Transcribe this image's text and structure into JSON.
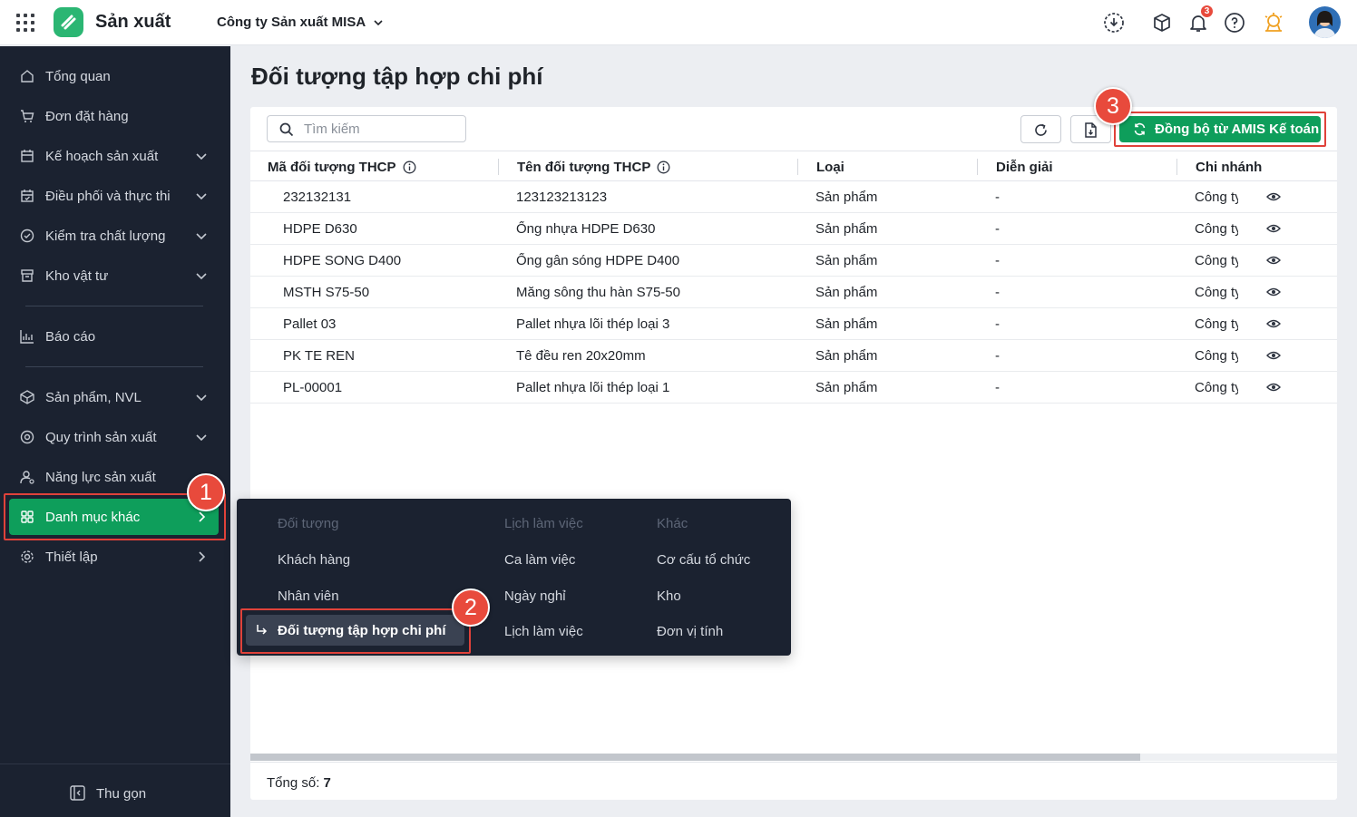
{
  "header": {
    "app_name": "Sản xuất",
    "company": "Công ty Sản xuất MISA",
    "notification_count": "3",
    "icons": [
      "apps-grid-icon",
      "download-icon",
      "box-icon",
      "bell-icon",
      "help-icon",
      "award-icon"
    ]
  },
  "sidebar": {
    "items": [
      {
        "label": "Tổng quan",
        "icon": "home-icon"
      },
      {
        "label": "Đơn đặt hàng",
        "icon": "cart-icon"
      },
      {
        "label": "Kế hoạch sản xuất",
        "icon": "calendar-icon"
      },
      {
        "label": "Điều phối và thực thi",
        "icon": "calendar-check-icon"
      },
      {
        "label": "Kiểm tra chất lượng",
        "icon": "quality-check-icon"
      },
      {
        "label": "Kho vật tư",
        "icon": "warehouse-icon"
      },
      {
        "label": "Báo cáo",
        "icon": "chart-icon"
      },
      {
        "label": "Sản phẩm, NVL",
        "icon": "product-icon"
      },
      {
        "label": "Quy trình sản xuất",
        "icon": "process-icon"
      },
      {
        "label": "Năng lực sản xuất",
        "icon": "capacity-icon"
      },
      {
        "label": "Danh mục khác",
        "icon": "grid-icon"
      },
      {
        "label": "Thiết lập",
        "icon": "settings-icon"
      }
    ],
    "collapse_label": "Thu gọn"
  },
  "page": {
    "title": "Đối tượng tập hợp chi phí",
    "search_placeholder": "Tìm kiếm",
    "sync_button": "Đồng bộ từ AMIS Kế toán"
  },
  "table": {
    "columns": [
      "Mã đối tượng THCP",
      "Tên đối tượng THCP",
      "Loại",
      "Diễn giải",
      "Chi nhánh"
    ],
    "rows": [
      {
        "code": "232132131",
        "name": "123123213123",
        "type": "Sản phẩm",
        "desc": "-",
        "branch": "Công ty"
      },
      {
        "code": "HDPE D630",
        "name": "Ống nhựa HDPE D630",
        "type": "Sản phẩm",
        "desc": "-",
        "branch": "Công ty"
      },
      {
        "code": "HDPE SONG D400",
        "name": "Ống gân sóng HDPE D400",
        "type": "Sản phẩm",
        "desc": "-",
        "branch": "Công ty"
      },
      {
        "code": "MSTH S75-50",
        "name": "Măng sông thu hàn S75-50",
        "type": "Sản phẩm",
        "desc": "-",
        "branch": "Công ty"
      },
      {
        "code": "Pallet 03",
        "name": "Pallet nhựa lõi thép loại 3",
        "type": "Sản phẩm",
        "desc": "-",
        "branch": "Công ty"
      },
      {
        "code": "PK TE REN",
        "name": "Tê đều ren 20x20mm",
        "type": "Sản phẩm",
        "desc": "-",
        "branch": "Công ty"
      },
      {
        "code": "PL-00001",
        "name": "Pallet nhựa lõi thép loại 1",
        "type": "Sản phẩm",
        "desc": "-",
        "branch": "Công ty"
      }
    ],
    "total_label": "Tổng số:",
    "total_value": "7"
  },
  "flyout": {
    "col1_header": "Đối tượng",
    "col1_items": [
      "Khách hàng",
      "Nhân viên",
      "Đối tượng tập hợp chi phí"
    ],
    "col2_header": "Lịch làm việc",
    "col2_items": [
      "Ca làm việc",
      "Ngày nghỉ",
      "Lịch làm việc"
    ],
    "col3_header": "Khác",
    "col3_items": [
      "Cơ cấu tổ chức",
      "Kho",
      "Đơn vị tính"
    ]
  },
  "steps": [
    "1",
    "2",
    "3"
  ],
  "colors": {
    "accent_green": "#0e9e5b",
    "sidebar_bg": "#1b2230",
    "highlight_red": "#e0423a"
  }
}
